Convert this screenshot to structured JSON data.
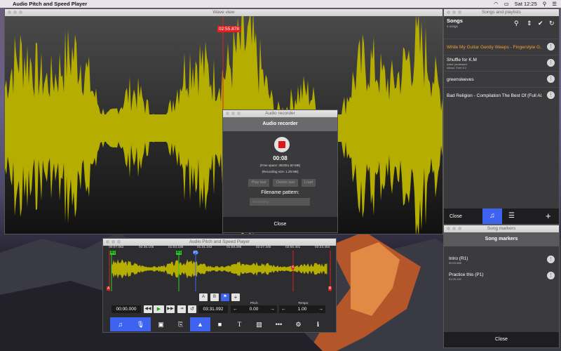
{
  "menubar": {
    "app_name": "Audio Pitch and Speed Player",
    "clock": "Sat 12:25"
  },
  "wave": {
    "title": "Wave view",
    "time_flag": "02:55.878"
  },
  "songs": {
    "title": "Songs and playlists",
    "heading": "Songs",
    "count": "4 songs",
    "items": [
      {
        "title": "While My Guitar Gently Weeps - Fingerstyle G...",
        "meta1": "",
        "meta2": "",
        "active": true
      },
      {
        "title": "Shuffle for K.M",
        "meta1": "Artist: jamieaard",
        "meta2": "Album: Feel It 2"
      },
      {
        "title": "greensleeves",
        "meta1": "",
        "meta2": ""
      },
      {
        "title": "Bad Religion - Compilation The Best Of (Full Al...",
        "meta1": "",
        "meta2": ""
      }
    ],
    "close": "Close"
  },
  "recorder": {
    "title": "Audio recorder",
    "heading": "Audio recorder",
    "time": "00:08",
    "free_space": "(Free space: 382351.60 MB)",
    "rec_size": "(Recording size: 1.28 MB)",
    "play_last": "Play last",
    "delete_last": "Delete last",
    "load": "Load",
    "pattern_label": "Filename pattern:",
    "pattern_placeholder": "recording",
    "close": "Close"
  },
  "markers": {
    "title": "Song markers",
    "heading": "Song markers",
    "items": [
      {
        "name": "Intro (R1)",
        "time": "00:03.985"
      },
      {
        "name": "Practice this (P1)",
        "time": "01:29.115"
      }
    ],
    "close": "Close"
  },
  "main": {
    "title": "Audio Pitch and Speed Player",
    "timeline": [
      "00:07.082",
      "00:35.105",
      "01:03.188",
      "01:31.242",
      "01:59.295",
      "02:27.348",
      "02:55.401",
      "03:23.454"
    ],
    "markers": {
      "r1a": "R1",
      "r1b": "R1",
      "p1": "P1",
      "a": "A",
      "b": "B",
      "x": "X"
    },
    "mode_a": "A",
    "mode_b": "B",
    "pos": "00:00.000",
    "duration": "03:31.092",
    "pitch_label": "Pitch",
    "pitch": "0.00",
    "tempo_label": "Tempo",
    "tempo": "1.00"
  },
  "colors": {
    "wave": "#b5ad00",
    "accent": "#3d63f0",
    "marker": "#e02020",
    "active_song": "#f0a030"
  }
}
